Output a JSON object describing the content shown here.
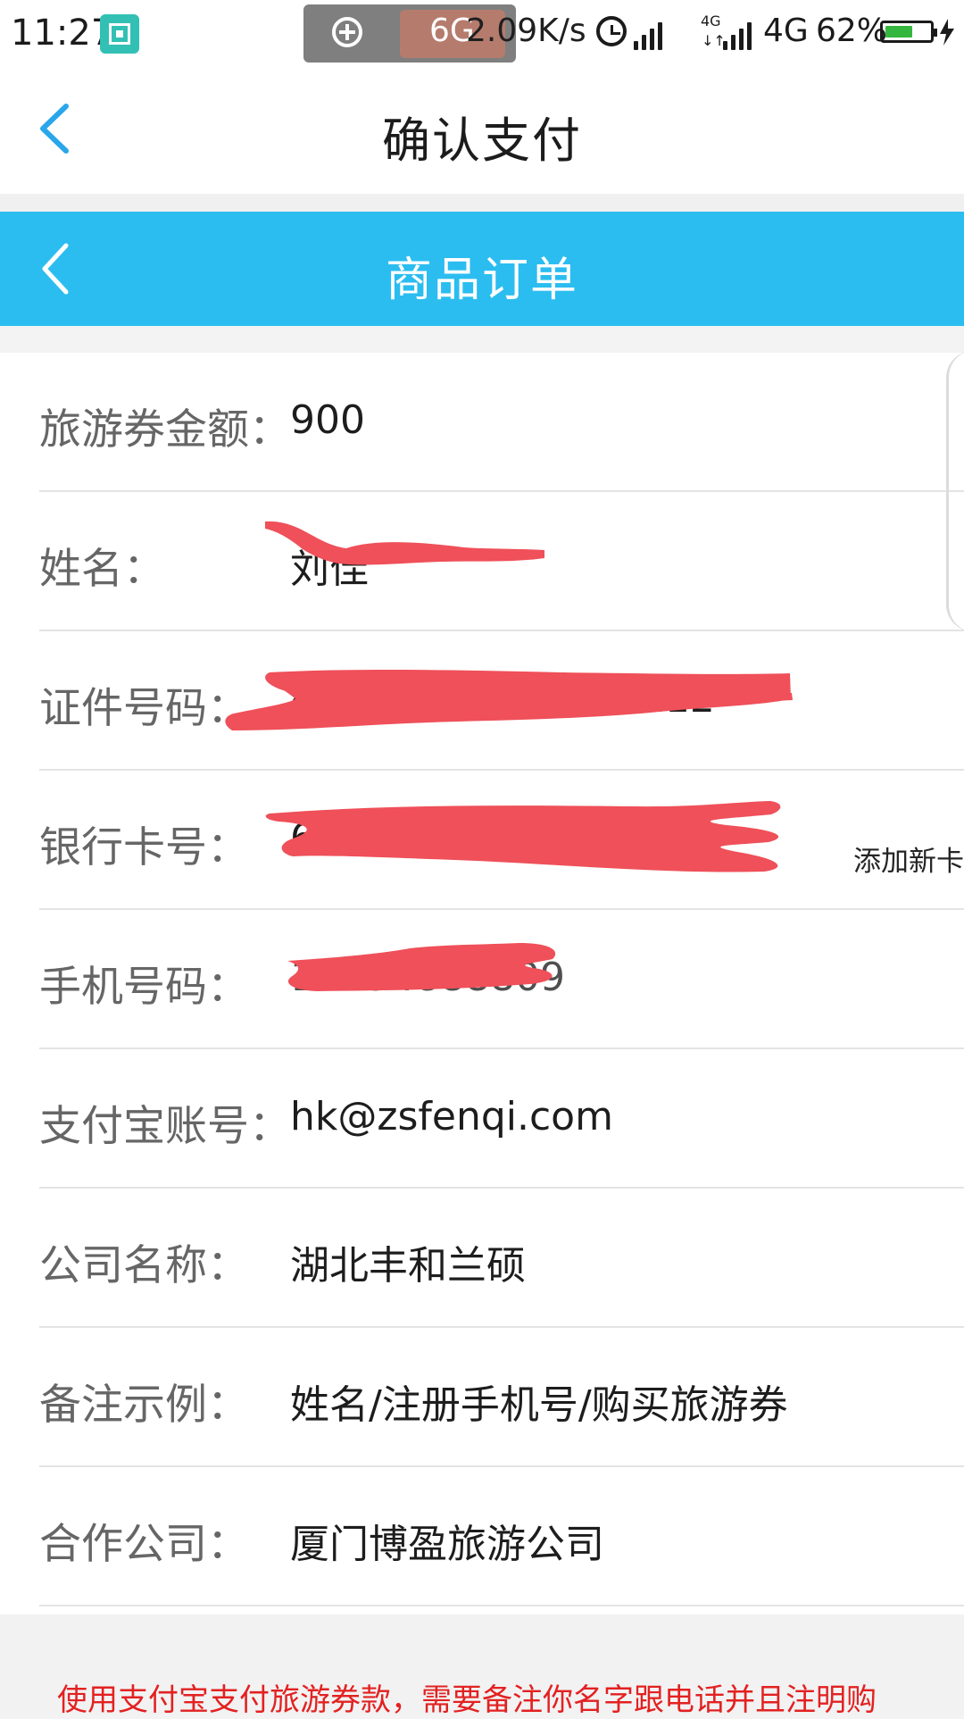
{
  "status_bar": {
    "time": "11:27",
    "network": "6G",
    "speed": "2.09K/s",
    "network_badge": "4G",
    "network_type": "4G",
    "battery": "62%",
    "battery_level": 0.62,
    "colors": {
      "screen_icon": "#32c0b4",
      "pill": "#7f7f7f",
      "battery": "#35b63e"
    }
  },
  "header": {
    "title": "确认支付",
    "back_icon": "chevron-left-icon"
  },
  "page_header": {
    "title": "商品订单",
    "back_icon": "chevron-left-icon",
    "color": "#2bbdf0"
  },
  "fields": [
    {
      "label": "旅游券金额：",
      "value": "900"
    },
    {
      "label": "姓名：",
      "value": "刘佳"
    },
    {
      "label": "证件号码：",
      "value": "42000000000000112"
    },
    {
      "label": "银行卡号：",
      "value": "6000000000000004"
    },
    {
      "label": "手机号码：",
      "value": "18794888809"
    },
    {
      "label": "支付宝账号：",
      "value": "hk@zsfenqi.com"
    },
    {
      "label": "公司名称：",
      "value": "湖北丰和兰硕"
    },
    {
      "label": "备注示例：",
      "value": "姓名/注册手机号/购买旅游券"
    },
    {
      "label": "合作公司：",
      "value": "厦门博盈旅游公司"
    }
  ],
  "actions": {
    "add_card_label": "添加新卡"
  },
  "notice": {
    "text": "使用支付宝支付旅游券款，需要备注你名字跟电话并且注明购",
    "color": "#e32121"
  },
  "redaction_color": "#ef5059"
}
